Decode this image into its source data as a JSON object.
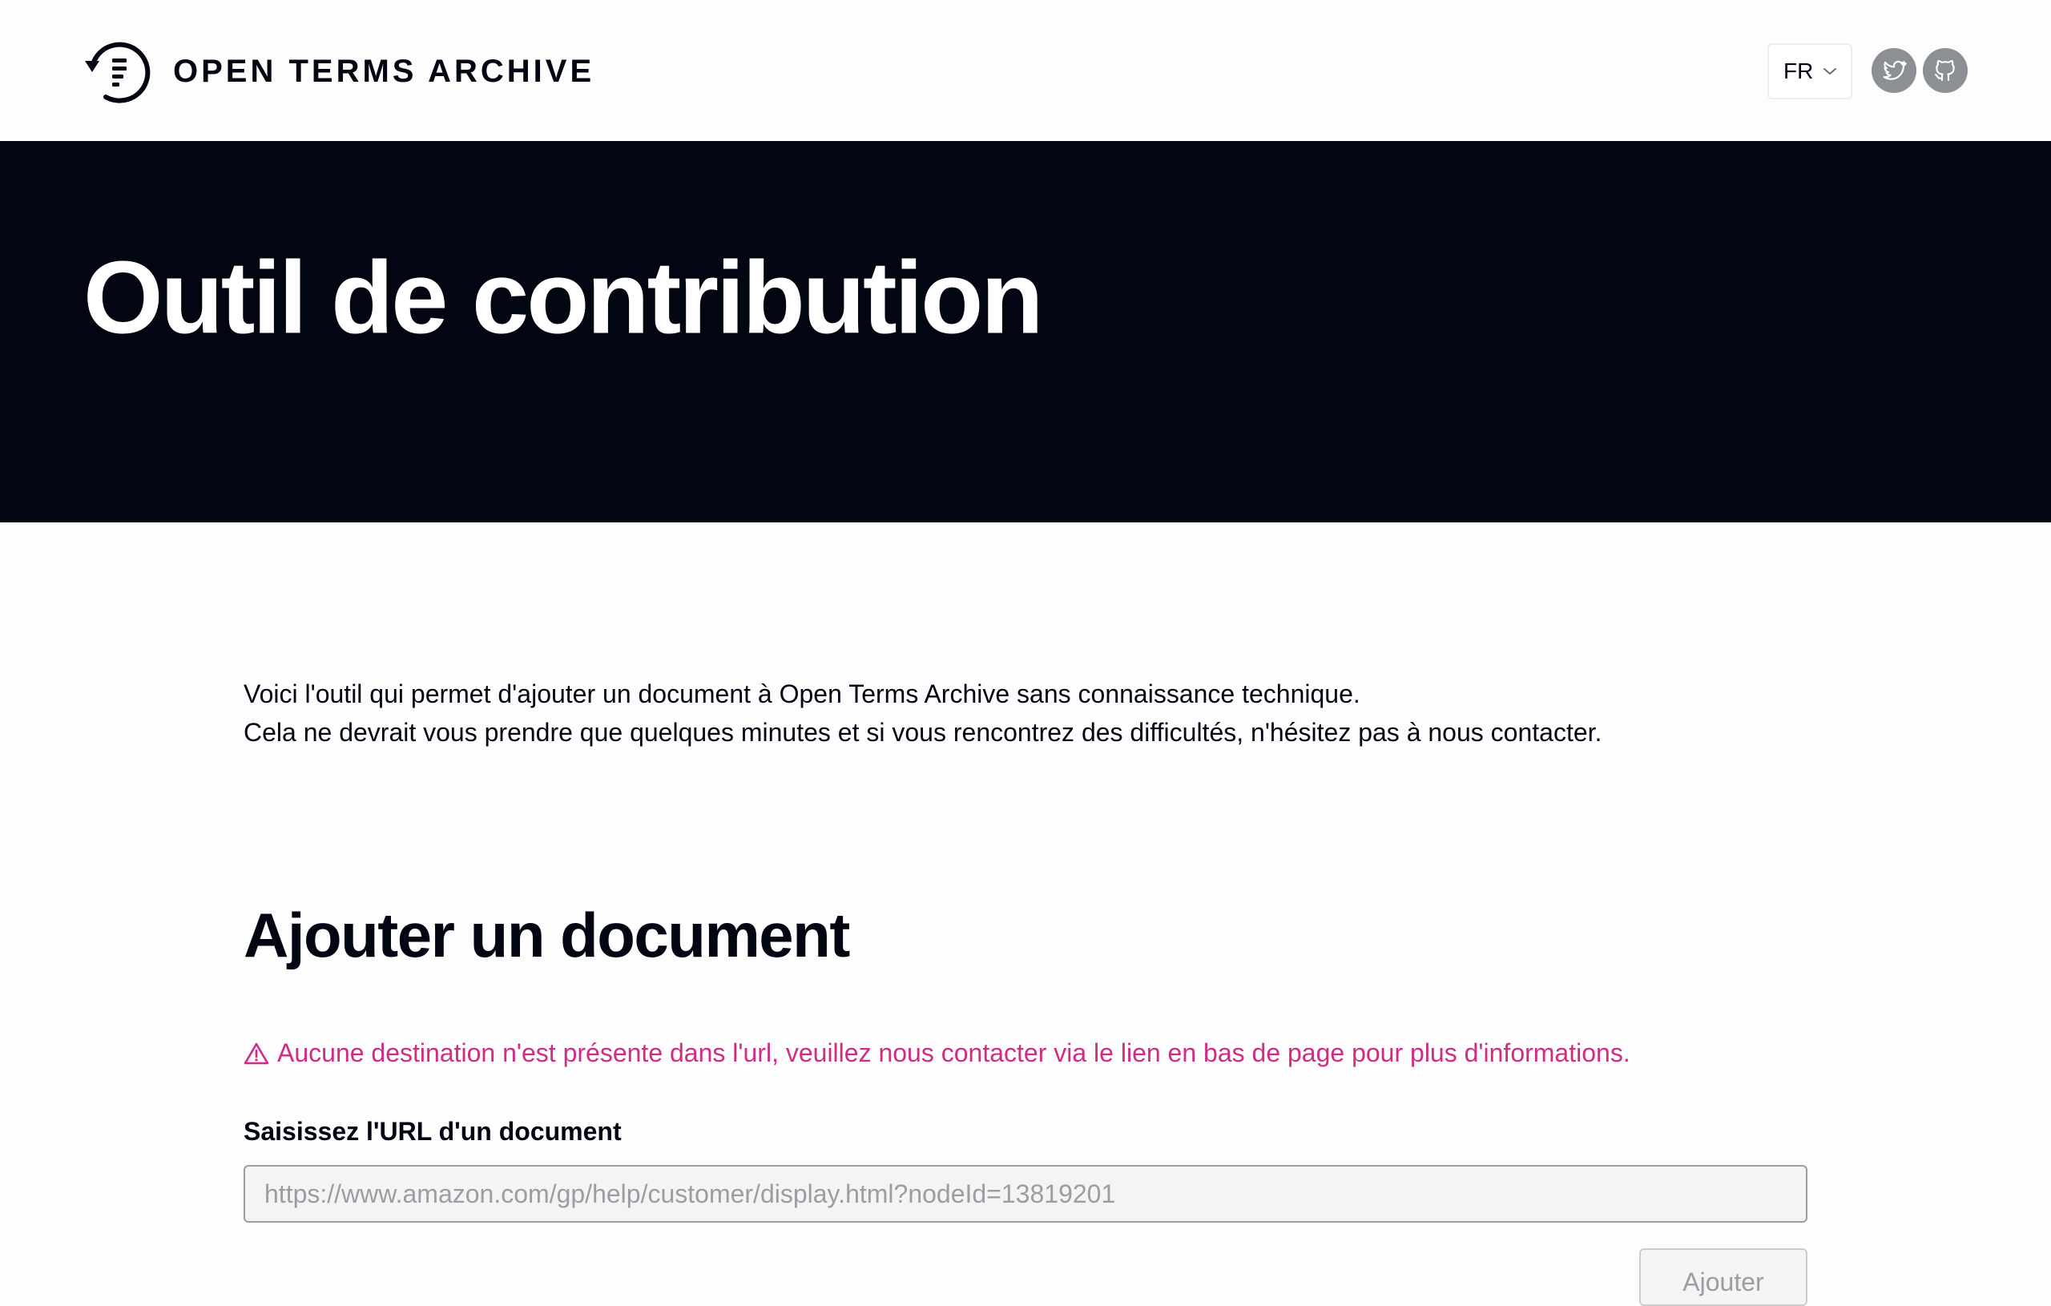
{
  "header": {
    "brand": "OPEN TERMS ARCHIVE",
    "logo_icon": "open-terms-archive-logo-icon",
    "language": {
      "selected": "FR",
      "icon": "chevron-down-icon"
    },
    "social": [
      {
        "name": "Twitter",
        "icon": "twitter-icon"
      },
      {
        "name": "GitHub",
        "icon": "github-icon"
      }
    ]
  },
  "hero": {
    "title": "Outil de contribution"
  },
  "intro": {
    "line1": "Voici l'outil qui permet d'ajouter un document à Open Terms Archive sans connaissance technique.",
    "line2": "Cela ne devrait vous prendre que quelques minutes et si vous rencontrez des difficultés, n'hésitez pas à nous contacter."
  },
  "form": {
    "title": "Ajouter un document",
    "alert": {
      "icon": "warning-triangle-icon",
      "text": "Aucune destination n'est présente dans l'url, veuillez nous contacter via le lien en bas de page pour plus d'informations."
    },
    "url_label": "Saisissez l'URL d'un document",
    "url_value": "",
    "url_placeholder": "https://www.amazon.com/gp/help/customer/display.html?nodeId=13819201",
    "submit_label": "Ajouter"
  },
  "colors": {
    "hero_background": "#010612",
    "text": "#010612",
    "alert": "#d12c84",
    "social_background": "#8c8f93",
    "input_background": "#f4f4f5",
    "input_border": "#9a9da2"
  }
}
